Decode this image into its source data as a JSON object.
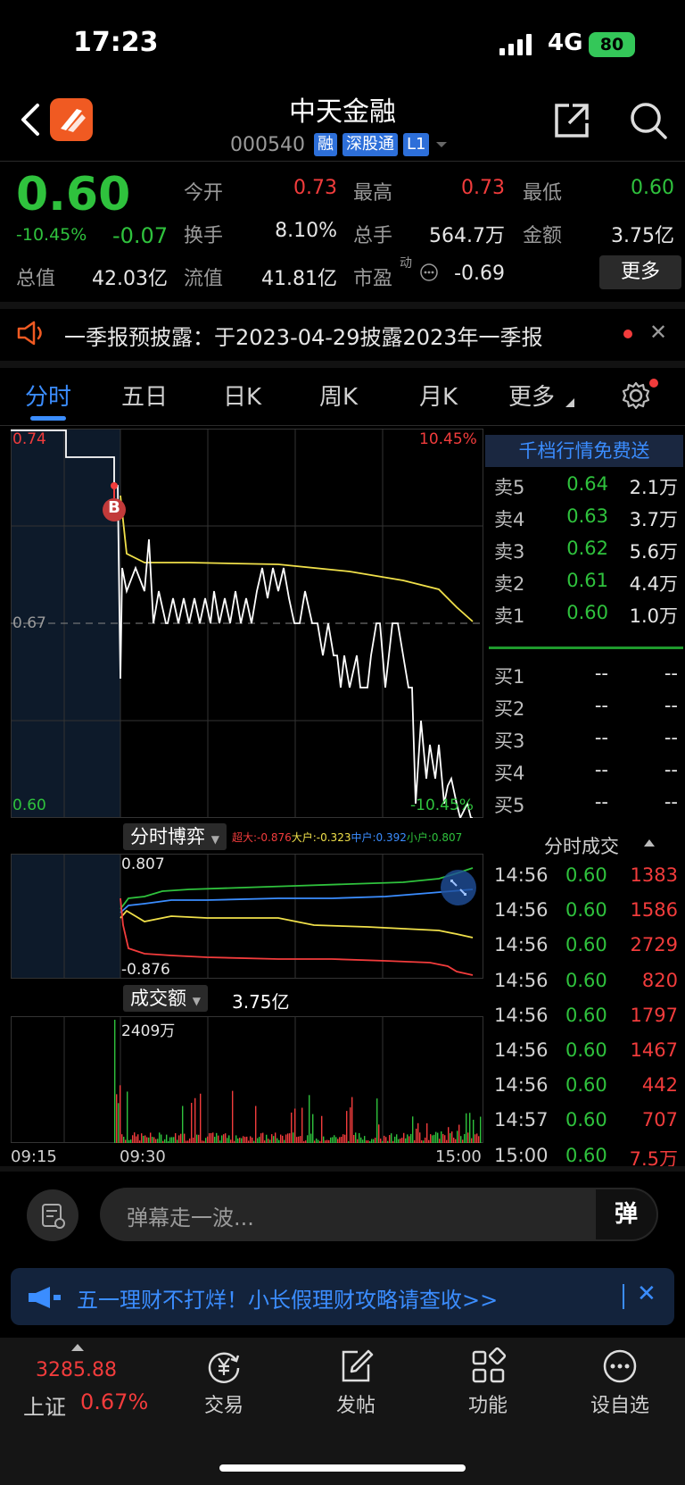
{
  "status": {
    "time": "17:23",
    "network": "4G",
    "battery": "80"
  },
  "header": {
    "name": "中天金融",
    "code": "000540",
    "tags": [
      "融",
      "深股通",
      "L1"
    ]
  },
  "quote": {
    "price": "0.60",
    "pct": "-10.45%",
    "change": "-0.07",
    "stats": [
      {
        "label": "今开",
        "value": "0.73"
      },
      {
        "label": "最高",
        "value": "0.73"
      },
      {
        "label": "最低",
        "value": "0.60"
      },
      {
        "label": "换手",
        "value": "8.10%"
      },
      {
        "label": "总手",
        "value": "564.7万"
      },
      {
        "label": "金额",
        "value": "3.75亿"
      },
      {
        "label": "总值",
        "value": "42.03亿"
      },
      {
        "label": "流值",
        "value": "41.81亿"
      },
      {
        "label": "市盈",
        "label_sup": "动",
        "value": "-0.69"
      }
    ],
    "more": "更多"
  },
  "notice": {
    "text": "一季报预披露：于2023-04-29披露2023年一季报"
  },
  "tabs": [
    "分时",
    "五日",
    "日K",
    "周K",
    "月K",
    "更多"
  ],
  "chart": {
    "y_top": "0.74",
    "y_mid": "0.67",
    "y_bottom": "0.60",
    "pct_top": "10.45%",
    "pct_bottom": "-10.45%",
    "marker": "B",
    "flow_label": "分时博弈",
    "flow_legend": [
      {
        "text": "超大:-0.876",
        "color": "#f23c3c"
      },
      {
        "text": "大户:-0.323",
        "color": "#f0e04a"
      },
      {
        "text": "中户:0.392",
        "color": "#3b8dff"
      },
      {
        "text": "小户:0.807",
        "color": "#2fc23d"
      }
    ],
    "flow_top": "0.807",
    "flow_bottom": "-0.876",
    "vol_label": "成交额",
    "vol_total": "3.75亿",
    "vol_max": "2409万",
    "times": [
      "09:15",
      "09:30",
      "15:00"
    ]
  },
  "orderbook": {
    "header": "千档行情免费送",
    "asks": [
      {
        "label": "卖5",
        "price": "0.64",
        "vol": "2.1万"
      },
      {
        "label": "卖4",
        "price": "0.63",
        "vol": "3.7万"
      },
      {
        "label": "卖3",
        "price": "0.62",
        "vol": "5.6万"
      },
      {
        "label": "卖2",
        "price": "0.61",
        "vol": "4.4万"
      },
      {
        "label": "卖1",
        "price": "0.60",
        "vol": "1.0万"
      }
    ],
    "bids": [
      {
        "label": "买1",
        "price": "--",
        "vol": "--"
      },
      {
        "label": "买2",
        "price": "--",
        "vol": "--"
      },
      {
        "label": "买3",
        "price": "--",
        "vol": "--"
      },
      {
        "label": "买4",
        "price": "--",
        "vol": "--"
      },
      {
        "label": "买5",
        "price": "--",
        "vol": "--"
      }
    ]
  },
  "trades": {
    "title": "分时成交",
    "rows": [
      {
        "time": "14:56",
        "price": "0.60",
        "vol": "1383"
      },
      {
        "time": "14:56",
        "price": "0.60",
        "vol": "1586"
      },
      {
        "time": "14:56",
        "price": "0.60",
        "vol": "2729"
      },
      {
        "time": "14:56",
        "price": "0.60",
        "vol": "820"
      },
      {
        "time": "14:56",
        "price": "0.60",
        "vol": "1797"
      },
      {
        "time": "14:56",
        "price": "0.60",
        "vol": "1467"
      },
      {
        "time": "14:56",
        "price": "0.60",
        "vol": "442"
      },
      {
        "time": "14:57",
        "price": "0.60",
        "vol": "707"
      },
      {
        "time": "15:00",
        "price": "0.60",
        "vol": "7.5万"
      }
    ]
  },
  "comment": {
    "placeholder": "弹幕走一波...",
    "danmu": "弹"
  },
  "banner": {
    "text": "五一理财不打烊！小长假理财攻略请查收>>"
  },
  "bottom": {
    "index_value": "3285.88",
    "index_name": "上证",
    "index_pct": "0.67%",
    "nav": [
      {
        "label": "交易",
        "icon": "yen-refresh-icon"
      },
      {
        "label": "发帖",
        "icon": "edit-icon"
      },
      {
        "label": "功能",
        "icon": "grid-icon"
      },
      {
        "label": "设自选",
        "icon": "more-dots-icon"
      }
    ]
  },
  "colors": {
    "up": "#f23c3c",
    "down": "#2fc23d",
    "accent": "#3b8dff",
    "avg_line": "#f0e04a"
  }
}
